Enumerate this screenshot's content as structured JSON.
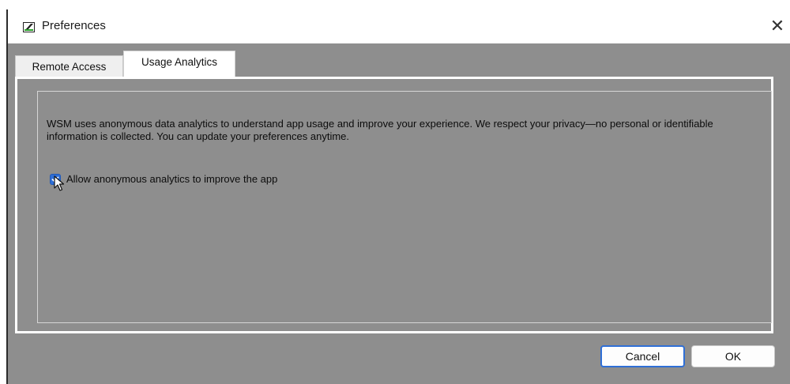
{
  "window": {
    "title": "Preferences",
    "close_glyph": "✕",
    "app_icon": "app-logo-icon"
  },
  "tabs": [
    {
      "label": "Remote Access",
      "selected": false
    },
    {
      "label": "Usage Analytics",
      "selected": true
    }
  ],
  "usage_analytics": {
    "description": "WSM uses anonymous data analytics to understand app usage and improve your experience. We respect your privacy—no personal or identifiable information is collected. You can update your preferences anytime.",
    "checkbox": {
      "label": "Allow anonymous analytics to improve the app",
      "checked": true
    }
  },
  "buttons": {
    "cancel_label": "Cancel",
    "ok_label": "OK"
  },
  "colors": {
    "accent": "#2f6fd6",
    "background": "#8e8e8e"
  }
}
